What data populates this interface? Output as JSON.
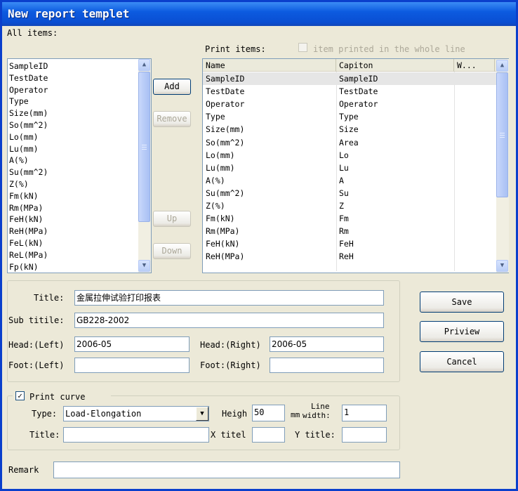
{
  "window": {
    "title": "New report templet"
  },
  "all_items": {
    "label": "All items:",
    "items": [
      "SampleID",
      "TestDate",
      "Operator",
      "Type",
      "Size(mm)",
      "So(mm^2)",
      "Lo(mm)",
      "Lu(mm)",
      "A(%)",
      "Su(mm^2)",
      "Z(%)",
      "Fm(kN)",
      "Rm(MPa)",
      "FeH(kN)",
      "ReH(MPa)",
      "FeL(kN)",
      "ReL(MPa)",
      "Fp(kN)"
    ]
  },
  "buttons": {
    "add": "Add",
    "remove": "Remove",
    "up": "Up",
    "down": "Down",
    "save": "Save",
    "preview": "Priview",
    "cancel": "Cancel"
  },
  "print_items": {
    "label": "Print items:",
    "whole_line_label": "item printed in the whole line",
    "whole_line_checked": false,
    "columns": [
      "Name",
      "Capiton",
      "W..."
    ],
    "rows": [
      [
        "SampleID",
        "SampleID"
      ],
      [
        "TestDate",
        "TestDate"
      ],
      [
        "Operator",
        "Operator"
      ],
      [
        "Type",
        "Type"
      ],
      [
        "Size(mm)",
        "Size"
      ],
      [
        "So(mm^2)",
        "Area"
      ],
      [
        "Lo(mm)",
        "Lo"
      ],
      [
        "Lu(mm)",
        "Lu"
      ],
      [
        "A(%)",
        "A"
      ],
      [
        "Su(mm^2)",
        "Su"
      ],
      [
        "Z(%)",
        "Z"
      ],
      [
        "Fm(kN)",
        "Fm"
      ],
      [
        "Rm(MPa)",
        "Rm"
      ],
      [
        "FeH(kN)",
        "FeH"
      ],
      [
        "ReH(MPa)",
        "ReH"
      ]
    ]
  },
  "header_form": {
    "title_label": "Title:",
    "title_value": "金属拉伸试验打印报表",
    "subtitle_label": "Sub titile:",
    "subtitle_value": "GB228-2002",
    "head_left_label": "Head:(Left)",
    "head_left_value": "2006-05",
    "head_right_label": "Head:(Right)",
    "head_right_value": "2006-05",
    "foot_left_label": "Foot:(Left)",
    "foot_left_value": "",
    "foot_right_label": "Foot:(Right)",
    "foot_right_value": ""
  },
  "curve": {
    "print_curve_label": "Print curve",
    "print_curve_checked": true,
    "type_label": "Type:",
    "type_value": "Load-Elongation",
    "height_label": "Heigh",
    "height_value": "50",
    "height_unit": "mm",
    "line_label_1": "Line",
    "line_label_2": "width:",
    "line_width_value": "1",
    "title_label": "Title:",
    "title_value": "",
    "x_title_label": "X titel",
    "x_title_value": "",
    "y_title_label": "Y title:",
    "y_title_value": ""
  },
  "remark": {
    "label": "Remark",
    "value": ""
  },
  "colors": {
    "titlebar": "#0a4ed2",
    "face": "#ece9d8",
    "border": "#7f9db9"
  }
}
